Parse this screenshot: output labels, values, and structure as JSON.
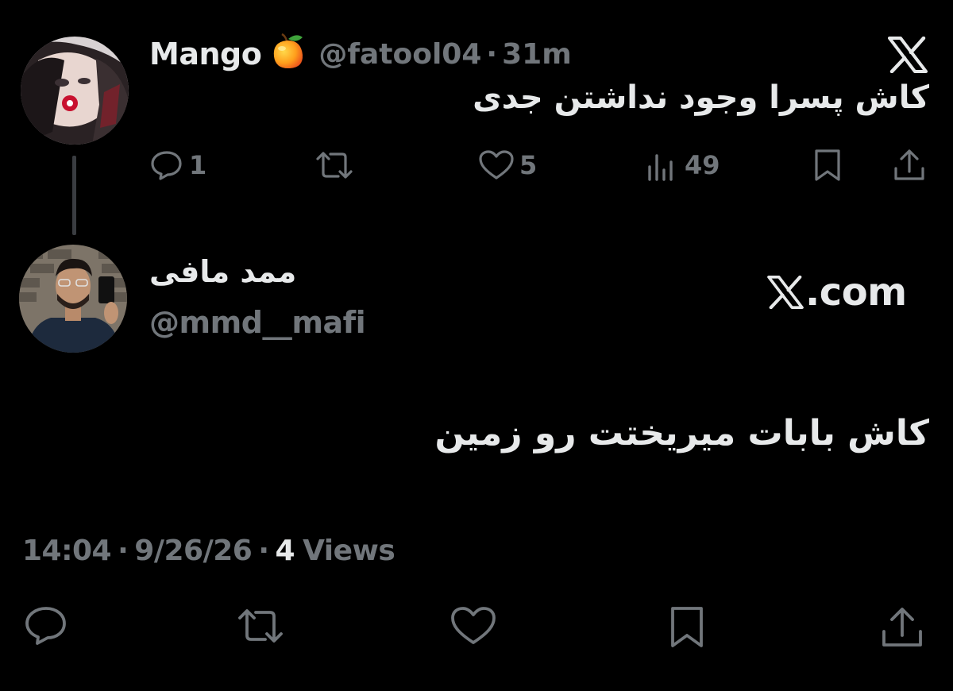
{
  "parent_tweet": {
    "display_name": "Mango",
    "name_emoji": "mango-emoji",
    "handle": "@fatool04",
    "separator": "·",
    "time_ago": "31m",
    "text": "کاش پسرا وجود نداشتن جدی",
    "actions": {
      "reply": {
        "icon": "reply-icon",
        "count": "1"
      },
      "retweet": {
        "icon": "retweet-icon",
        "count": ""
      },
      "like": {
        "icon": "heart-icon",
        "count": "5"
      },
      "views": {
        "icon": "views-icon",
        "count": "49"
      },
      "bookmark": {
        "icon": "bookmark-icon"
      },
      "share": {
        "icon": "share-icon"
      }
    }
  },
  "reply_tweet": {
    "display_name": "ممد مافی",
    "handle": "@mmd__mafi",
    "text": "کاش بابات میریختت رو زمین",
    "timestamp_time": "14:04",
    "separator": "·",
    "timestamp_date": "9/26/26",
    "views_count": "4",
    "views_label": "Views",
    "actions": [
      "reply-icon",
      "retweet-icon",
      "heart-icon",
      "bookmark-icon",
      "share-icon"
    ]
  },
  "branding": {
    "top_logo": "x-logo-icon",
    "site_label": ".com"
  },
  "colors": {
    "background": "#000000",
    "primary_text": "#e7e9ea",
    "secondary_text": "#71767b",
    "thread_line": "#3a3d41"
  }
}
